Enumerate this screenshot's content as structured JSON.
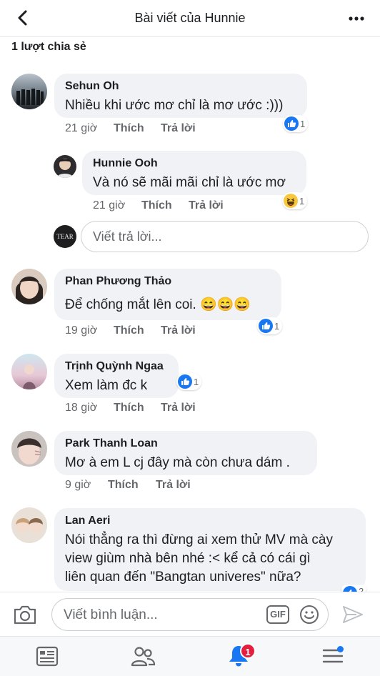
{
  "header": {
    "title": "Bài viết của Hunnie"
  },
  "shares": "1 lượt chia sẻ",
  "comments": [
    {
      "author": "Sehun Oh",
      "text": "Nhiều khi ước mơ chỉ là mơ ước :)))",
      "time": "21 giờ",
      "like": "Thích",
      "reply": "Trả lời",
      "reaction": "like",
      "reaction_count": "1"
    },
    {
      "author": "Hunnie Ooh",
      "text": "Và nó sẽ mãi mãi chỉ là ước mơ",
      "time": "21 giờ",
      "like": "Thích",
      "reply": "Trả lời",
      "reaction": "haha",
      "reaction_count": "1"
    },
    {
      "author": "Phan Phương Thảo",
      "text": "Để chống mắt lên coi. 😄😄😄",
      "time": "19 giờ",
      "like": "Thích",
      "reply": "Trả lời",
      "reaction": "like",
      "reaction_count": "1"
    },
    {
      "author": "Trịnh Quỳnh Ngaa",
      "text": "Xem làm đc k",
      "time": "18 giờ",
      "like": "Thích",
      "reply": "Trả lời",
      "reaction": "like",
      "reaction_count": "1"
    },
    {
      "author": "Park Thanh Loan",
      "text": "Mơ à em L cj đây mà còn chưa dám .",
      "time": "9 giờ",
      "like": "Thích",
      "reply": "Trả lời"
    },
    {
      "author": "Lan Aeri",
      "text_lines": [
        "Nói thẳng ra thì đừng ai xem thử MV mà cày",
        "view giùm nhà bên nhé :< kể cả có cái gì",
        "liên quan đến \"Bangtan univeres\" nữa?"
      ],
      "reaction": "like",
      "reaction_count": "2"
    }
  ],
  "reply_input": {
    "placeholder": "Viết trả lời..."
  },
  "composer": {
    "placeholder": "Viết bình luận...",
    "gif_label": "GIF"
  },
  "tabbar": {
    "notifications_badge": "1"
  },
  "colors": {
    "accent": "#1877f2",
    "bubble": "#f0f2f5",
    "badge": "#e41e3f"
  }
}
